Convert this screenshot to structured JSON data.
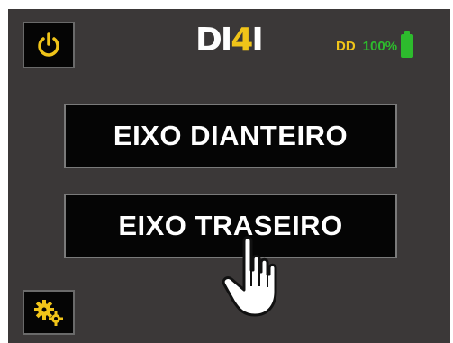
{
  "header": {
    "logo_text_main": "DI",
    "logo_text_accent": "4",
    "logo_text_end": "I",
    "mode_label": "DD",
    "battery_percent": "100%"
  },
  "buttons": {
    "front_axle": "EIXO DIANTEIRO",
    "rear_axle": "EIXO TRASEIRO"
  },
  "icons": {
    "power": "power-icon",
    "battery": "battery-icon",
    "settings": "gears-icon",
    "cursor": "hand-pointer-icon"
  },
  "colors": {
    "background": "#3b3838",
    "accent": "#f0c419",
    "battery": "#2dbb2d",
    "button_bg": "#050505"
  }
}
